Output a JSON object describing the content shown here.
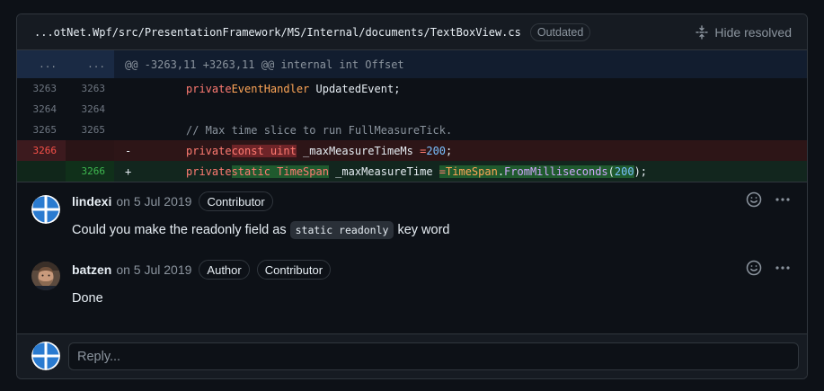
{
  "file": {
    "path": "...otNet.Wpf/src/PresentationFramework/MS/Internal/documents/TextBoxView.cs",
    "status_badge": "Outdated",
    "hide_resolved_label": "Hide resolved"
  },
  "diff": {
    "hunk": {
      "left": "...",
      "right": "...",
      "text": "@@ -3263,11 +3263,11 @@ internal int Offset"
    },
    "lines": [
      {
        "old": "3263",
        "new": "3263",
        "type": "context"
      },
      {
        "old": "3264",
        "new": "3264",
        "type": "context"
      },
      {
        "old": "3265",
        "new": "3265",
        "type": "context"
      },
      {
        "old": "3266",
        "new": "",
        "type": "deletion"
      },
      {
        "old": "",
        "new": "3266",
        "type": "addition"
      }
    ],
    "tokens": {
      "l1_kw": "private",
      "l1_type": "EventHandler",
      "l1_rest": " UpdatedEvent;",
      "l3_comment": "// Max time slice to run FullMeasureTick.",
      "del_marker": "-",
      "del_kw": "private",
      "del_changed": "const uint",
      "del_name": " _maxMeasureTimeMs ",
      "del_eq": "=",
      "del_num": "200",
      "del_end": ";",
      "add_marker": "+",
      "add_kw": "private",
      "add_changed": "static TimeSpan",
      "add_name": " _maxMeasureTime ",
      "add_eq": "=",
      "add_call_type": "TimeSpan",
      "add_call_dot": ".",
      "add_call_fn": "FromMilliseconds",
      "add_paren_open": "(",
      "add_num": "200",
      "add_end": ");"
    }
  },
  "comments": [
    {
      "author": "lindexi",
      "date": "on 5 Jul 2019",
      "badges": [
        "Contributor"
      ],
      "body_before": "Could you make the readonly field as",
      "body_code": "static readonly",
      "body_after": "key word"
    },
    {
      "author": "batzen",
      "date": "on 5 Jul 2019",
      "badges": [
        "Author",
        "Contributor"
      ],
      "body": "Done"
    }
  ],
  "reply": {
    "placeholder": "Reply..."
  },
  "icons": {
    "hide_resolved": "fold-icon",
    "reaction": "smiley-icon",
    "more": "kebab-horizontal-icon"
  },
  "colors": {
    "deletion_bg": "#2d1517",
    "addition_bg": "#12261e",
    "accent": "#79c0ff"
  }
}
